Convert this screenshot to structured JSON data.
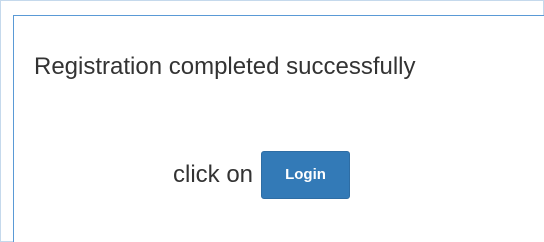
{
  "panel": {
    "message": "Registration completed successfully",
    "action_prefix": "click on",
    "login_label": "Login"
  },
  "colors": {
    "primary_button": "#337ab7",
    "panel_border": "#5a9ad6",
    "text": "#333333"
  }
}
